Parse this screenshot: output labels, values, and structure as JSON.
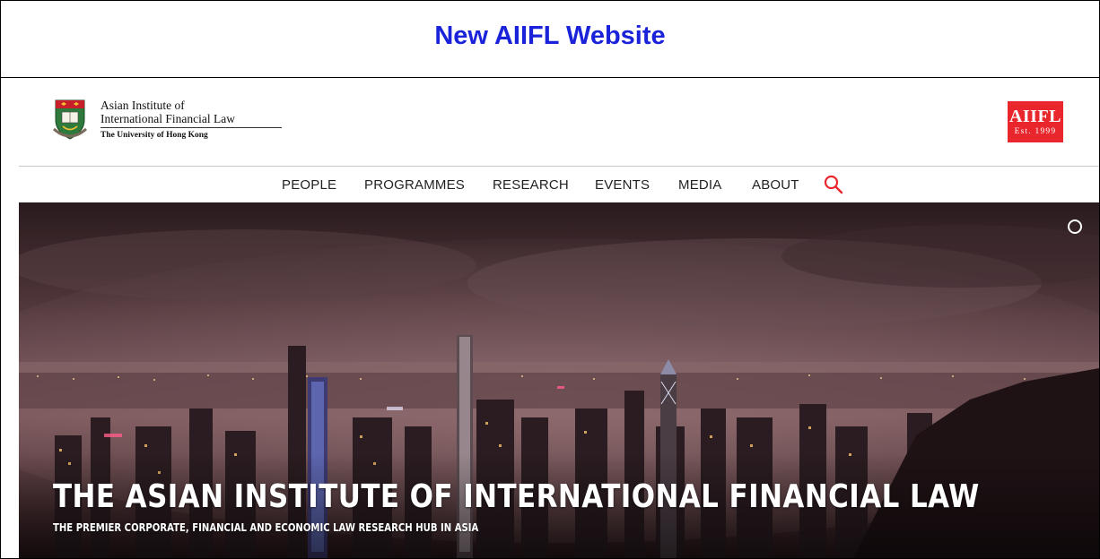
{
  "banner": {
    "title": "New AIIFL Website"
  },
  "header": {
    "logo": {
      "line1": "Asian Institute of",
      "line2": "International Financial Law",
      "line3": "The University of Hong Kong",
      "crest_icon": "hku-crest-icon"
    },
    "badge": {
      "main": "AIIFL",
      "sub": "Est. 1999",
      "color": "#e8262c"
    }
  },
  "nav": {
    "items": [
      {
        "label": "PEOPLE"
      },
      {
        "label": "PROGRAMMES"
      },
      {
        "label": "RESEARCH"
      },
      {
        "label": "EVENTS"
      },
      {
        "label": "MEDIA"
      },
      {
        "label": "ABOUT"
      }
    ],
    "search_icon": "search-icon",
    "search_color": "#e8262c"
  },
  "hero": {
    "headline": "THE ASIAN INSTITUTE OF INTERNATIONAL FINANCIAL LAW",
    "subheadline": "THE PREMIER CORPORATE, FINANCIAL AND ECONOMIC LAW RESEARCH HUB IN ASIA",
    "image": "hong-kong-night-skyline"
  },
  "colors": {
    "banner_title": "#1a23d9",
    "accent": "#e8262c"
  }
}
